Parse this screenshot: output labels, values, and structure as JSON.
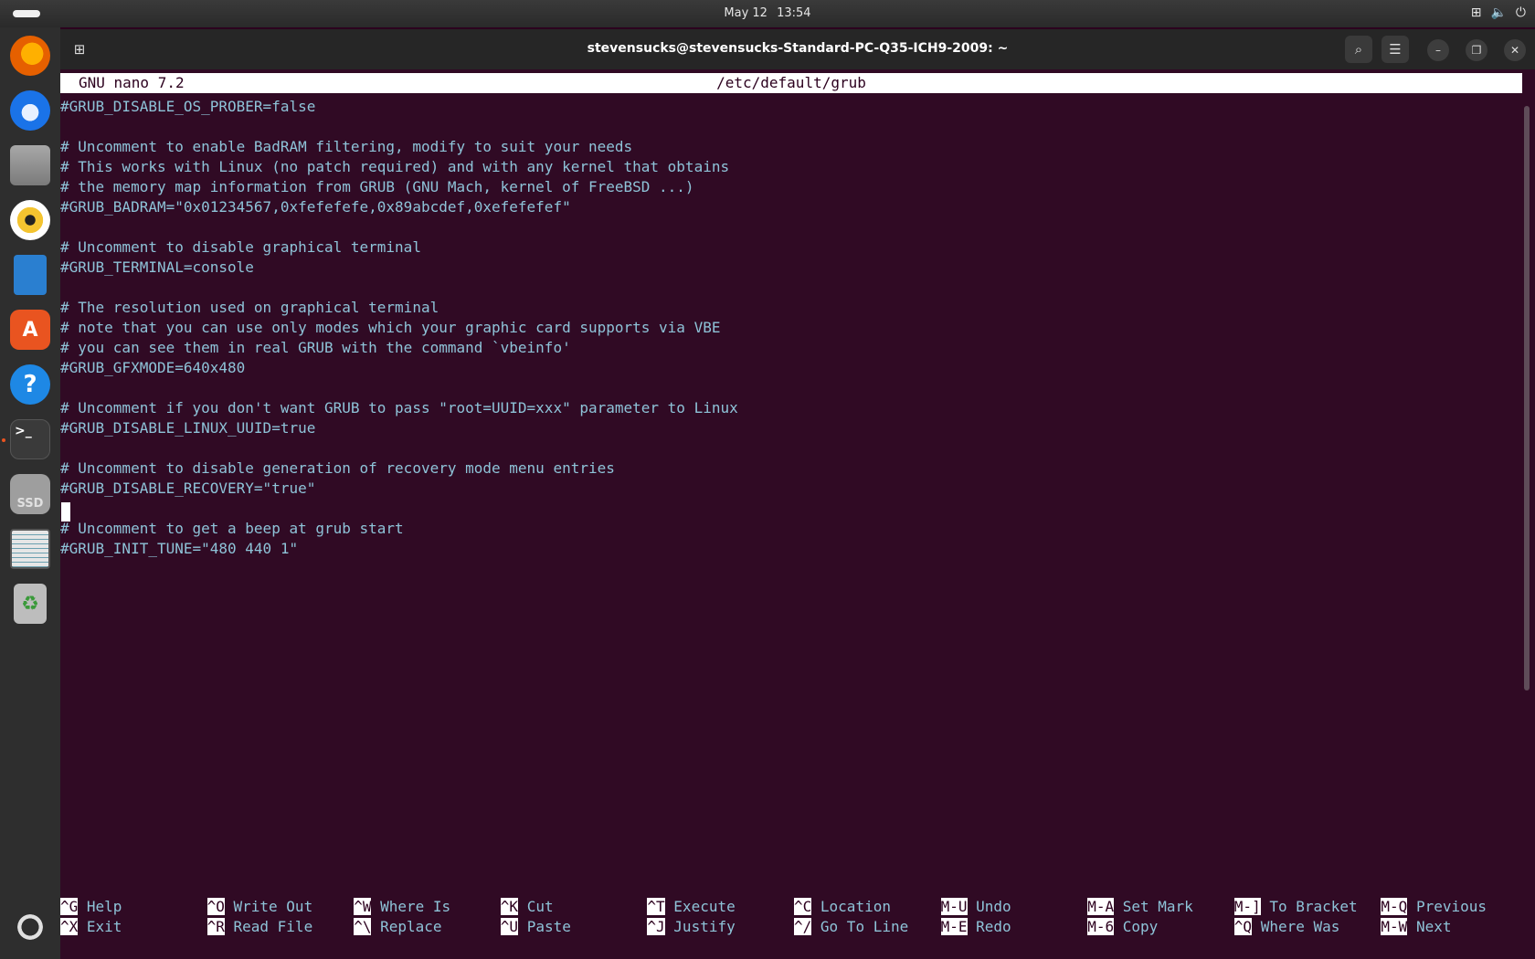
{
  "topbar": {
    "date": "May 12",
    "time": "13:54"
  },
  "dock": {
    "items": [
      {
        "name": "firefox",
        "glyph": "",
        "color": "#e66000"
      },
      {
        "name": "thunderbird",
        "glyph": "",
        "color": "#1a73e8"
      },
      {
        "name": "files",
        "glyph": "",
        "color": "#8a8a8a"
      },
      {
        "name": "rhythmbox",
        "glyph": "",
        "color": "#f4c430"
      },
      {
        "name": "libreoffice-writer",
        "glyph": "",
        "color": "#2a7fd0"
      },
      {
        "name": "app-center",
        "glyph": "A",
        "color": "#e95420"
      },
      {
        "name": "help",
        "glyph": "?",
        "color": "#1e88e5"
      },
      {
        "name": "terminal",
        "glyph": ">_",
        "color": "#3a3a3a"
      },
      {
        "name": "ssd-drive",
        "glyph": "SSD",
        "color": "#9e9e9e"
      },
      {
        "name": "disk-image",
        "glyph": "",
        "color": "#d8d8d8"
      },
      {
        "name": "trash",
        "glyph": "♻",
        "color": "#b0b0b0"
      },
      {
        "name": "show-apps",
        "glyph": "",
        "color": "#2e2e2e"
      }
    ]
  },
  "window": {
    "title": "stevensucks@stevensucks-Standard-PC-Q35-ICH9-2009: ~"
  },
  "nano": {
    "version": "GNU nano 7.2",
    "filename": "/etc/default/grub",
    "lines": [
      "#GRUB_DISABLE_OS_PROBER=false",
      "",
      "# Uncomment to enable BadRAM filtering, modify to suit your needs",
      "# This works with Linux (no patch required) and with any kernel that obtains",
      "# the memory map information from GRUB (GNU Mach, kernel of FreeBSD ...)",
      "#GRUB_BADRAM=\"0x01234567,0xfefefefe,0x89abcdef,0xefefefef\"",
      "",
      "# Uncomment to disable graphical terminal",
      "#GRUB_TERMINAL=console",
      "",
      "# The resolution used on graphical terminal",
      "# note that you can use only modes which your graphic card supports via VBE",
      "# you can see them in real GRUB with the command `vbeinfo'",
      "#GRUB_GFXMODE=640x480",
      "",
      "# Uncomment if you don't want GRUB to pass \"root=UUID=xxx\" parameter to Linux",
      "#GRUB_DISABLE_LINUX_UUID=true",
      "",
      "# Uncomment to disable generation of recovery mode menu entries",
      "#GRUB_DISABLE_RECOVERY=\"true\"",
      "",
      "# Uncomment to get a beep at grub start",
      "#GRUB_INIT_TUNE=\"480 440 1\""
    ],
    "shortcuts_row1": [
      {
        "key": "^G",
        "label": "Help"
      },
      {
        "key": "^O",
        "label": "Write Out"
      },
      {
        "key": "^W",
        "label": "Where Is"
      },
      {
        "key": "^K",
        "label": "Cut"
      },
      {
        "key": "^T",
        "label": "Execute"
      },
      {
        "key": "^C",
        "label": "Location"
      },
      {
        "key": "M-U",
        "label": "Undo"
      },
      {
        "key": "M-A",
        "label": "Set Mark"
      },
      {
        "key": "M-]",
        "label": "To Bracket"
      },
      {
        "key": "M-Q",
        "label": "Previous"
      }
    ],
    "shortcuts_row2": [
      {
        "key": "^X",
        "label": "Exit"
      },
      {
        "key": "^R",
        "label": "Read File"
      },
      {
        "key": "^\\",
        "label": "Replace"
      },
      {
        "key": "^U",
        "label": "Paste"
      },
      {
        "key": "^J",
        "label": "Justify"
      },
      {
        "key": "^/",
        "label": "Go To Line"
      },
      {
        "key": "M-E",
        "label": "Redo"
      },
      {
        "key": "M-6",
        "label": "Copy"
      },
      {
        "key": "^Q",
        "label": "Where Was"
      },
      {
        "key": "M-W",
        "label": "Next"
      }
    ]
  }
}
